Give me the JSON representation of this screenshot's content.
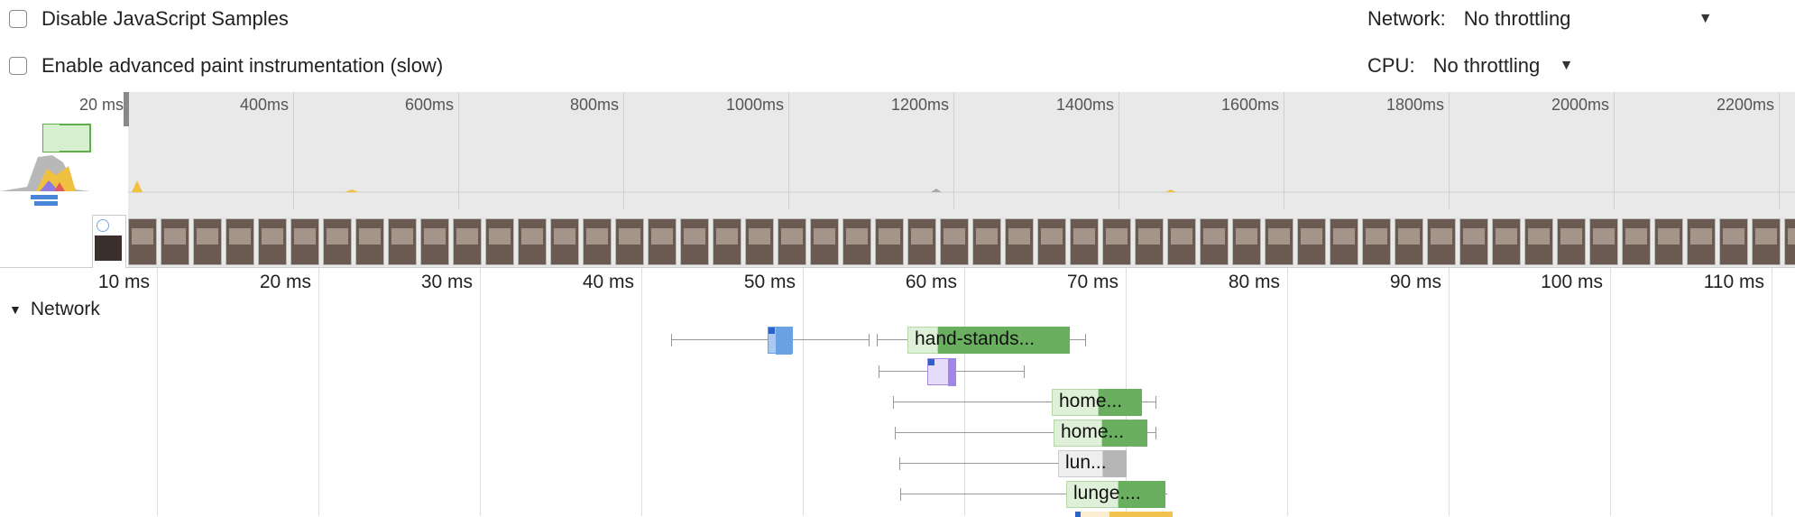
{
  "toolbar": {
    "disable_js_samples": {
      "label": "Disable JavaScript Samples",
      "checked": false
    },
    "advanced_paint": {
      "label": "Enable advanced paint instrumentation (slow)",
      "checked": false
    },
    "network": {
      "label": "Network:",
      "value": "No throttling",
      "caret": "▼"
    },
    "cpu": {
      "label": "CPU:",
      "value": "No throttling",
      "caret": "▼"
    }
  },
  "overview": {
    "ticks": [
      "20 ms",
      "400ms",
      "600ms",
      "800ms",
      "1000ms",
      "1200ms",
      "1400ms",
      "1600ms",
      "1800ms",
      "2000ms",
      "2200ms"
    ]
  },
  "timeline": {
    "ticks": [
      "10 ms",
      "20 ms",
      "30 ms",
      "40 ms",
      "50 ms",
      "60 ms",
      "70 ms",
      "80 ms",
      "90 ms",
      "100 ms",
      "110 ms"
    ],
    "network_label": "Network",
    "requests": [
      {
        "label": "hand-stands..."
      },
      {
        "label": "home..."
      },
      {
        "label": "home..."
      },
      {
        "label": "lun..."
      },
      {
        "label": "lunge...."
      }
    ]
  },
  "colors": {
    "accent_green": "#6aaf5f",
    "light_green": "#dff0d8",
    "blue": "#6aa1e2",
    "purple": "#a186e6",
    "gray_bar": "#b5b5b5",
    "orange": "#f2c14e"
  }
}
